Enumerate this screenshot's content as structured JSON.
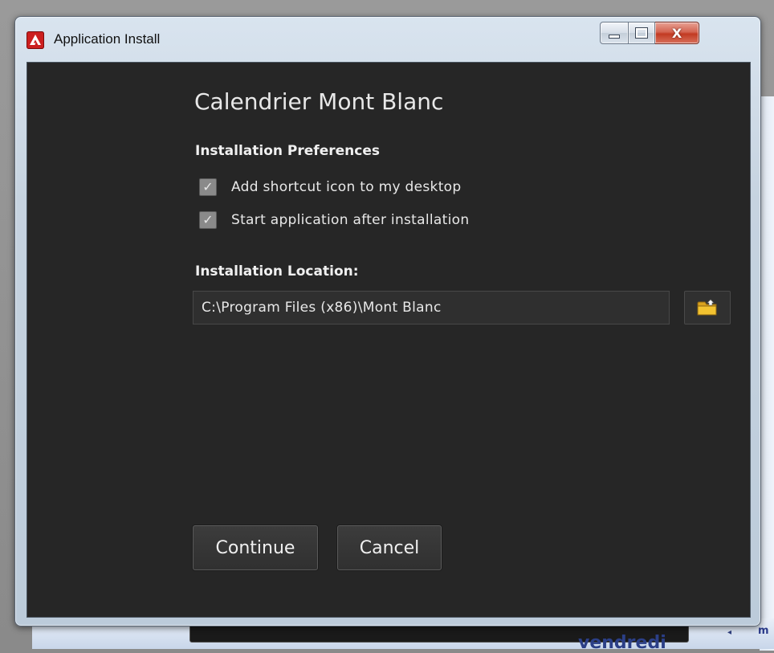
{
  "window": {
    "title": "Application Install",
    "caption": {
      "close_glyph": "X"
    }
  },
  "installer": {
    "app_name": "Calendrier Mont Blanc",
    "preferences_heading": "Installation Preferences",
    "options": [
      {
        "label": "Add shortcut icon to my desktop",
        "checked": true
      },
      {
        "label": "Start application after installation",
        "checked": true
      }
    ],
    "location_heading": "Installation Location:",
    "location_value": "C:\\Program Files (x86)\\Mont Blanc",
    "continue_label": "Continue",
    "cancel_label": "Cancel"
  },
  "background": {
    "partial_bottom_text": "vendredi",
    "partial_right_text": "m"
  },
  "colors": {
    "client_bg": "#262626",
    "accent_icon": "#cc1f1f",
    "folder_icon": "#f2c230"
  },
  "icons": {
    "app": "adobe-air-icon",
    "browse": "folder-icon",
    "check": "checkmark-icon"
  }
}
